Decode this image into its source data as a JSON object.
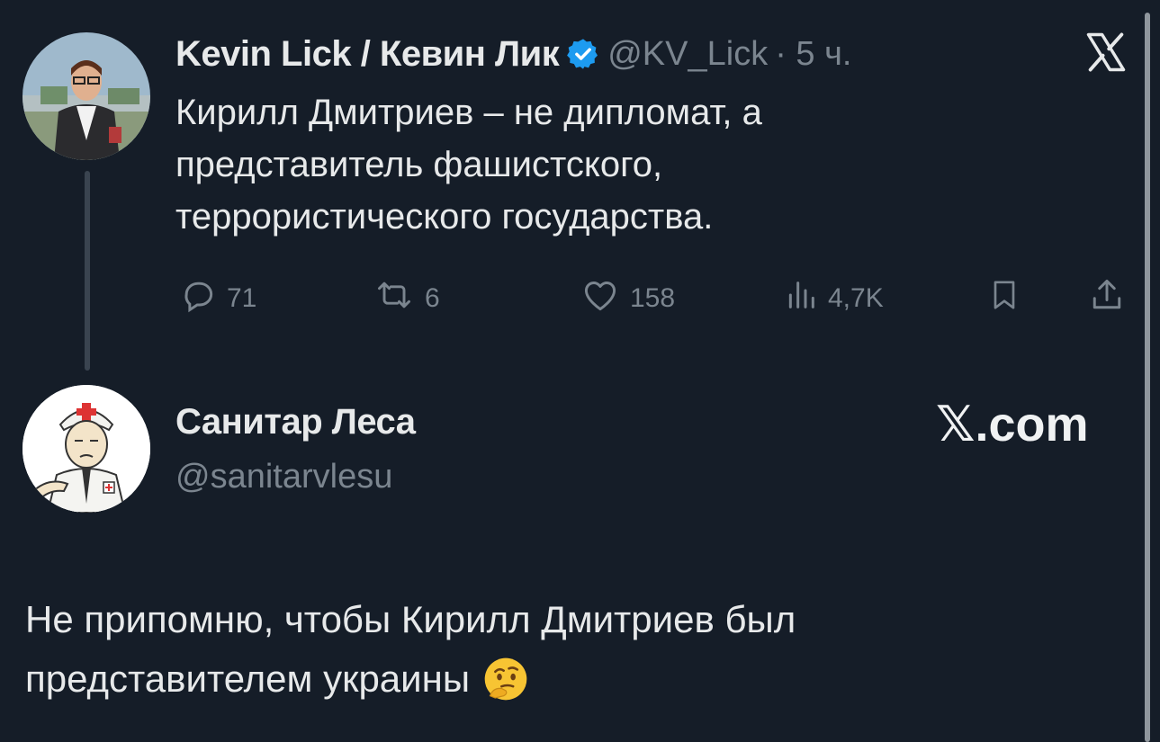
{
  "quoted_tweet": {
    "author_name": "Kevin Lick / Кевин Лик",
    "verified": true,
    "handle": "@KV_Lick",
    "time": "· 5 ч.",
    "text_lines": [
      "Кирилл Дмитриев – не дипломат, а",
      "представитель фашистского,",
      "террористического государства."
    ],
    "actions": {
      "replies": "71",
      "reposts": "6",
      "likes": "158",
      "views": "4,7K"
    },
    "icons": [
      "x-logo-icon",
      "reply-icon",
      "repost-icon",
      "like-icon",
      "views-icon",
      "bookmark-icon",
      "share-icon"
    ]
  },
  "reply_tweet": {
    "author_name": "Санитар Леса",
    "handle": "@sanitarvlesu",
    "brand": "𝕏.com",
    "text_lines": [
      "Не припомню, чтобы Кирилл Дмитриев был",
      "представителем украины"
    ],
    "emoji": "🤔"
  },
  "colors": {
    "background": "#151d28",
    "text": "#e7e9ea",
    "muted": "#7b858f",
    "verified": "#1d9bf0"
  }
}
